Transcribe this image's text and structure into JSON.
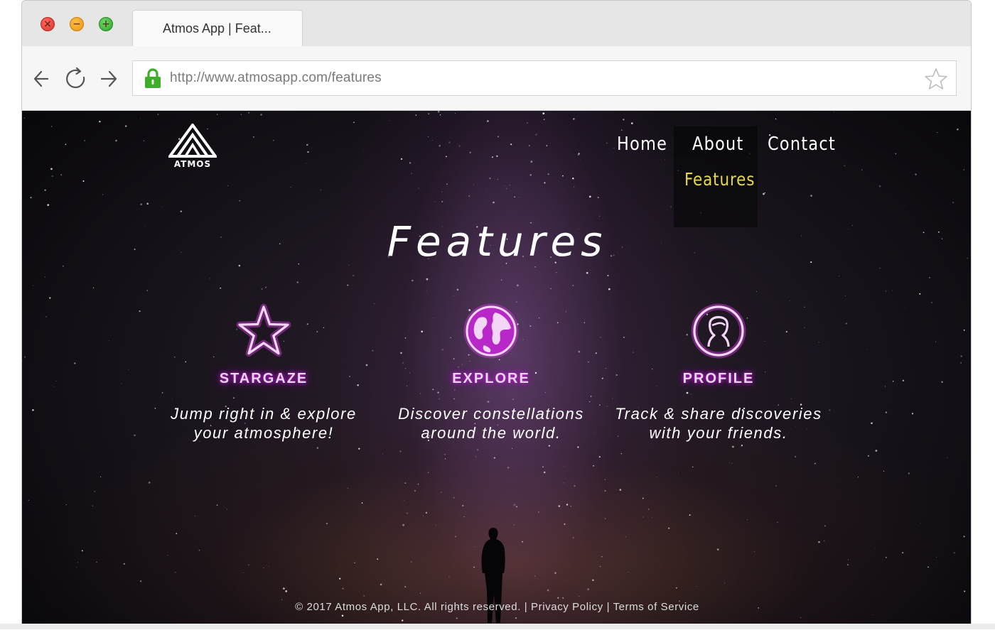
{
  "window": {
    "tab_title": "Atmos App | Feat...",
    "url": "http://www.atmosapp.com/features",
    "controls": {
      "close": "×",
      "minimize": "−",
      "maximize": "+"
    }
  },
  "site": {
    "logo_text": "ATMOS",
    "nav": {
      "home": "Home",
      "about": "About",
      "contact": "Contact"
    },
    "about_dropdown": {
      "features": "Features"
    },
    "page_title": "Features",
    "features": [
      {
        "title": "STARGAZE",
        "line1": "Jump right in & explore",
        "line2": "your atmosphere!",
        "icon": "star-icon"
      },
      {
        "title": "EXPLORE",
        "line1": "Discover constellations",
        "line2": "around the world.",
        "icon": "globe-icon"
      },
      {
        "title": "PROFILE",
        "line1": "Track & share discoveries",
        "line2": "with your friends.",
        "icon": "user-profile-icon"
      }
    ],
    "footer": {
      "copyright": "© 2017 Atmos App, LLC. All rights reserved.",
      "separator": "|",
      "privacy": "Privacy Policy",
      "terms": "Terms of Service"
    },
    "colors": {
      "accent_glow": "#c81ed8",
      "dropdown_text": "#e6d84a"
    }
  }
}
